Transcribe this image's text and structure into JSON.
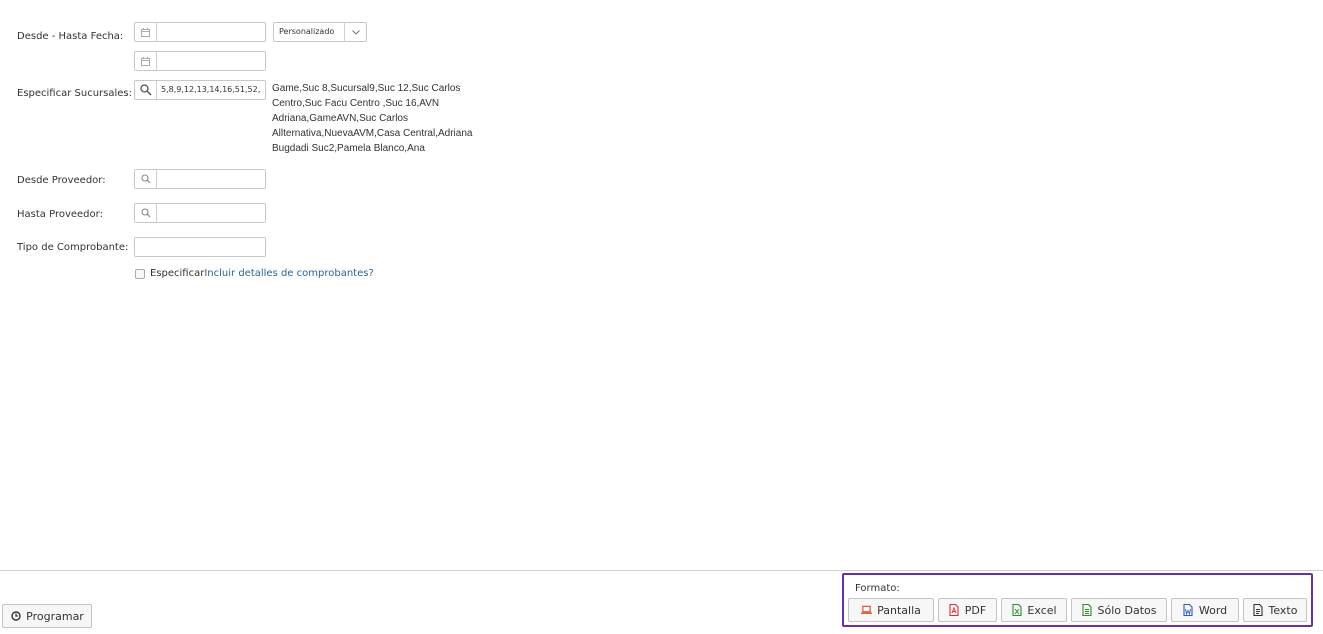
{
  "form": {
    "fecha_label": "Desde - Hasta Fecha:",
    "fecha_desde_value": "",
    "fecha_hasta_value": "",
    "periodo_select": "Personalizado",
    "sucursales_label": "Especificar Sucursales:",
    "sucursales_value": "5,8,9,12,13,14,16,51,52,5(",
    "sucursales_names": "Game,Suc 8,Sucursal9,Suc 12,Suc Carlos Centro,Suc Facu Centro ,Suc 16,AVN Adriana,GameAVN,Suc Carlos Allternativa,NuevaAVM,Casa Central,Adriana Bugdadi Suc2,Pamela Blanco,Ana",
    "desde_proveedor_label": "Desde Proveedor:",
    "desde_proveedor_value": "",
    "hasta_proveedor_label": "Hasta Proveedor:",
    "hasta_proveedor_value": "",
    "tipo_comprobante_label": "Tipo de Comprobante:",
    "tipo_comprobante_value": "",
    "checkbox_prefix": "Especificar",
    "checkbox_text": " Incluir detalles de comprobantes?"
  },
  "footer": {
    "programar_label": "Programar",
    "formato_label": "Formato:",
    "buttons": {
      "pantalla": "Pantalla",
      "pdf": "PDF",
      "excel": "Excel",
      "solo_datos": "Sólo Datos",
      "word": "Word",
      "texto": "Texto"
    }
  },
  "colors": {
    "format_border": "#6b2fa0",
    "pantalla": "#e0461d",
    "pdf": "#d9302f",
    "excel": "#2e8b2e",
    "solo_datos": "#2e8b2e",
    "word": "#2b5fb4"
  }
}
